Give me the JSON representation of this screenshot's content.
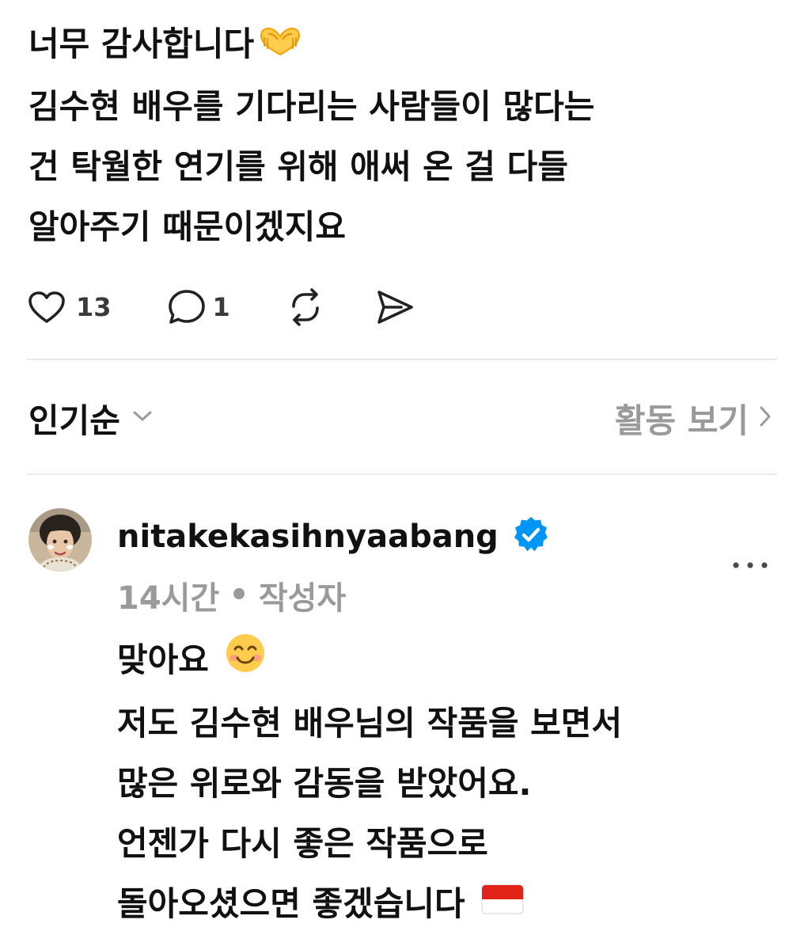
{
  "post": {
    "lines": [
      "너무 감사합니다🫶",
      "김수현 배우를 기다리는 사람들이 많다는",
      "건 탁월한 연기를 위해 애써 온 걸 다들",
      "알아주기 때문이겠지요"
    ],
    "line1_text": "너무 감사합니다",
    "line1_emoji": "🫶",
    "like_count": "13",
    "reply_count": "1",
    "icons": [
      "heart-icon",
      "comment-icon",
      "repost-icon",
      "send-icon"
    ]
  },
  "sort_bar": {
    "sort_label": "인기순",
    "activity_label": "활동 보기",
    "icons": [
      "chevron-down-icon",
      "chevron-right-icon"
    ]
  },
  "reply": {
    "username": "nitakekasihnyaabang",
    "verified": true,
    "time": "14시간",
    "separator": "•",
    "author_label": "작성자",
    "line1_text": "맞아요",
    "line1_emoji": "😊",
    "lines": [
      "맞아요 😊",
      "저도 김수현 배우님의 작품을 보면서",
      "많은 위로와 감동을 받았어요.",
      "언젠가 다시 좋은 작품으로",
      "돌아오셨으면 좋겠습니다 🇮🇩"
    ],
    "line5_text": "돌아오셨으면 좋겠습니다",
    "line5_emoji": "🇮🇩",
    "icons": [
      "avatar",
      "verified-badge-icon",
      "more-options-icon",
      "smiling-face-emoji",
      "indonesia-flag-emoji"
    ]
  },
  "colors": {
    "text_primary": "#111111",
    "text_secondary": "#9a9a9a",
    "verified_blue": "#0095f6",
    "divider": "#ebebeb"
  }
}
